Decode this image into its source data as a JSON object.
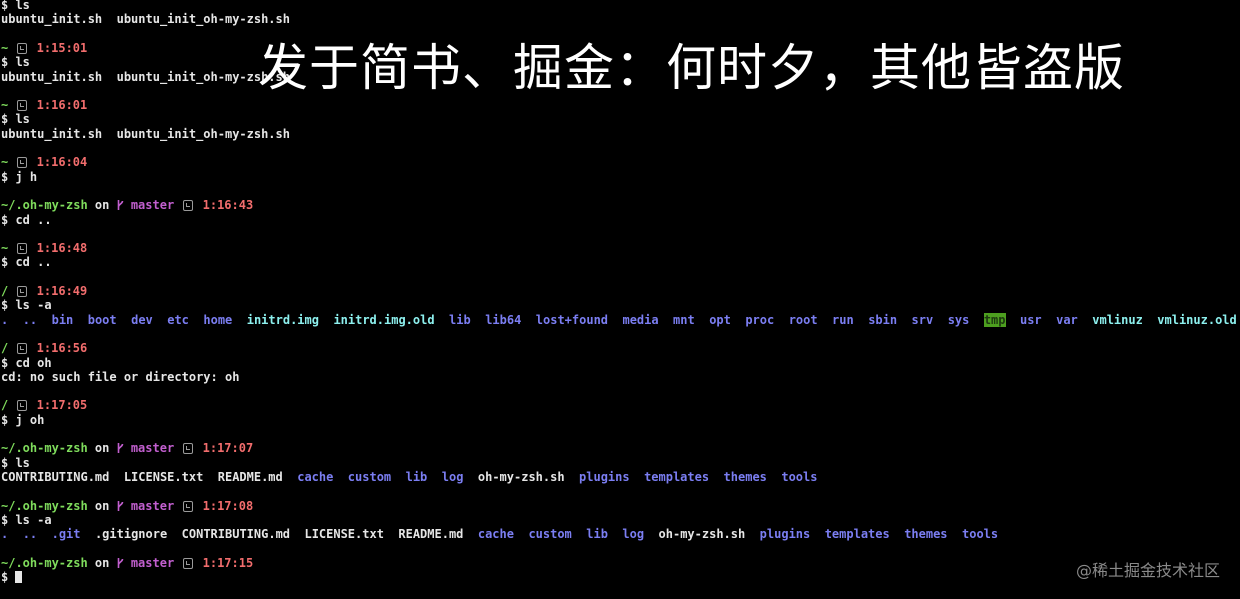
{
  "overlay": {
    "watermark": "发于简书、掘金：何时夕，其他皆盗版",
    "credit": "@稀土掘金技术社区"
  },
  "colors": {
    "path": "#7fdc5c",
    "branch": "#c25fcf",
    "time": "#f26d6d",
    "directory": "#7b7ef2",
    "symlink": "#8df0ee",
    "sticky_dir_bg": "#4d9f1f"
  },
  "terminal": {
    "lines": [
      [
        {
          "t": "$ ls",
          "s": "w"
        }
      ],
      [
        {
          "t": "ubuntu_init.sh  ubuntu_init_oh-my-zsh.sh",
          "s": "w"
        }
      ],
      [],
      [
        {
          "t": "~ ",
          "s": "g"
        },
        {
          "i": "clock-icon"
        },
        {
          "t": " 1:15:01",
          "s": "r"
        }
      ],
      [
        {
          "t": "$ ls",
          "s": "w"
        }
      ],
      [
        {
          "t": "ubuntu_init.sh  ubuntu_init_oh-my-zsh.sh",
          "s": "w"
        }
      ],
      [],
      [
        {
          "t": "~ ",
          "s": "g"
        },
        {
          "i": "clock-icon"
        },
        {
          "t": " 1:16:01",
          "s": "r"
        }
      ],
      [
        {
          "t": "$ ls",
          "s": "w"
        }
      ],
      [
        {
          "t": "ubuntu_init.sh  ubuntu_init_oh-my-zsh.sh",
          "s": "w"
        }
      ],
      [],
      [
        {
          "t": "~ ",
          "s": "g"
        },
        {
          "i": "clock-icon"
        },
        {
          "t": " 1:16:04",
          "s": "r"
        }
      ],
      [
        {
          "t": "$ j h",
          "s": "w"
        }
      ],
      [],
      [
        {
          "t": "~/.oh-my-zsh",
          "s": "g"
        },
        {
          "t": " on ",
          "s": "w"
        },
        {
          "i": "git-branch-icon"
        },
        {
          "t": " master ",
          "s": "m"
        },
        {
          "i": "clock-icon"
        },
        {
          "t": " 1:16:43",
          "s": "r"
        }
      ],
      [
        {
          "t": "$ cd ..",
          "s": "w"
        }
      ],
      [],
      [
        {
          "t": "~ ",
          "s": "g"
        },
        {
          "i": "clock-icon"
        },
        {
          "t": " 1:16:48",
          "s": "r"
        }
      ],
      [
        {
          "t": "$ cd ..",
          "s": "w"
        }
      ],
      [],
      [
        {
          "t": "/ ",
          "s": "g"
        },
        {
          "i": "clock-icon"
        },
        {
          "t": " 1:16:49",
          "s": "r"
        }
      ],
      [
        {
          "t": "$ ls -a",
          "s": "w"
        }
      ],
      [
        {
          "t": ".",
          "s": "b"
        },
        {
          "t": "  ",
          "s": "w"
        },
        {
          "t": "..",
          "s": "b"
        },
        {
          "t": "  ",
          "s": "w"
        },
        {
          "t": "bin",
          "s": "b"
        },
        {
          "t": "  ",
          "s": "w"
        },
        {
          "t": "boot",
          "s": "b"
        },
        {
          "t": "  ",
          "s": "w"
        },
        {
          "t": "dev",
          "s": "b"
        },
        {
          "t": "  ",
          "s": "w"
        },
        {
          "t": "etc",
          "s": "b"
        },
        {
          "t": "  ",
          "s": "w"
        },
        {
          "t": "home",
          "s": "b"
        },
        {
          "t": "  ",
          "s": "w"
        },
        {
          "t": "initrd.img",
          "s": "c"
        },
        {
          "t": "  ",
          "s": "w"
        },
        {
          "t": "initrd.img.old",
          "s": "c"
        },
        {
          "t": "  ",
          "s": "w"
        },
        {
          "t": "lib",
          "s": "b"
        },
        {
          "t": "  ",
          "s": "w"
        },
        {
          "t": "lib64",
          "s": "b"
        },
        {
          "t": "  ",
          "s": "w"
        },
        {
          "t": "lost+found",
          "s": "b"
        },
        {
          "t": "  ",
          "s": "w"
        },
        {
          "t": "media",
          "s": "b"
        },
        {
          "t": "  ",
          "s": "w"
        },
        {
          "t": "mnt",
          "s": "b"
        },
        {
          "t": "  ",
          "s": "w"
        },
        {
          "t": "opt",
          "s": "b"
        },
        {
          "t": "  ",
          "s": "w"
        },
        {
          "t": "proc",
          "s": "b"
        },
        {
          "t": "  ",
          "s": "w"
        },
        {
          "t": "root",
          "s": "b"
        },
        {
          "t": "  ",
          "s": "w"
        },
        {
          "t": "run",
          "s": "b"
        },
        {
          "t": "  ",
          "s": "w"
        },
        {
          "t": "sbin",
          "s": "b"
        },
        {
          "t": "  ",
          "s": "w"
        },
        {
          "t": "srv",
          "s": "b"
        },
        {
          "t": "  ",
          "s": "w"
        },
        {
          "t": "sys",
          "s": "b"
        },
        {
          "t": "  ",
          "s": "w"
        },
        {
          "t": "tmp",
          "s": "t"
        },
        {
          "t": "  ",
          "s": "w"
        },
        {
          "t": "usr",
          "s": "b"
        },
        {
          "t": "  ",
          "s": "w"
        },
        {
          "t": "var",
          "s": "b"
        },
        {
          "t": "  ",
          "s": "w"
        },
        {
          "t": "vmlinuz",
          "s": "c"
        },
        {
          "t": "  ",
          "s": "w"
        },
        {
          "t": "vmlinuz.old",
          "s": "c"
        }
      ],
      [],
      [
        {
          "t": "/ ",
          "s": "g"
        },
        {
          "i": "clock-icon"
        },
        {
          "t": " 1:16:56",
          "s": "r"
        }
      ],
      [
        {
          "t": "$ cd oh",
          "s": "w"
        }
      ],
      [
        {
          "t": "cd: no such file or directory: oh",
          "s": "w"
        }
      ],
      [],
      [
        {
          "t": "/ ",
          "s": "g"
        },
        {
          "i": "clock-icon"
        },
        {
          "t": " 1:17:05",
          "s": "r"
        }
      ],
      [
        {
          "t": "$ j oh",
          "s": "w"
        }
      ],
      [],
      [
        {
          "t": "~/.oh-my-zsh",
          "s": "g"
        },
        {
          "t": " on ",
          "s": "w"
        },
        {
          "i": "git-branch-icon"
        },
        {
          "t": " master ",
          "s": "m"
        },
        {
          "i": "clock-icon"
        },
        {
          "t": " 1:17:07",
          "s": "r"
        }
      ],
      [
        {
          "t": "$ ls",
          "s": "w"
        }
      ],
      [
        {
          "t": "CONTRIBUTING.md  LICENSE.txt  README.md  ",
          "s": "w"
        },
        {
          "t": "cache",
          "s": "b"
        },
        {
          "t": "  ",
          "s": "w"
        },
        {
          "t": "custom",
          "s": "b"
        },
        {
          "t": "  ",
          "s": "w"
        },
        {
          "t": "lib",
          "s": "b"
        },
        {
          "t": "  ",
          "s": "w"
        },
        {
          "t": "log",
          "s": "b"
        },
        {
          "t": "  oh-my-zsh.sh  ",
          "s": "w"
        },
        {
          "t": "plugins",
          "s": "b"
        },
        {
          "t": "  ",
          "s": "w"
        },
        {
          "t": "templates",
          "s": "b"
        },
        {
          "t": "  ",
          "s": "w"
        },
        {
          "t": "themes",
          "s": "b"
        },
        {
          "t": "  ",
          "s": "w"
        },
        {
          "t": "tools",
          "s": "b"
        }
      ],
      [],
      [
        {
          "t": "~/.oh-my-zsh",
          "s": "g"
        },
        {
          "t": " on ",
          "s": "w"
        },
        {
          "i": "git-branch-icon"
        },
        {
          "t": " master ",
          "s": "m"
        },
        {
          "i": "clock-icon"
        },
        {
          "t": " 1:17:08",
          "s": "r"
        }
      ],
      [
        {
          "t": "$ ls -a",
          "s": "w"
        }
      ],
      [
        {
          "t": ".",
          "s": "b"
        },
        {
          "t": "  ",
          "s": "w"
        },
        {
          "t": "..",
          "s": "b"
        },
        {
          "t": "  ",
          "s": "w"
        },
        {
          "t": ".git",
          "s": "b"
        },
        {
          "t": "  .gitignore  CONTRIBUTING.md  LICENSE.txt  README.md  ",
          "s": "w"
        },
        {
          "t": "cache",
          "s": "b"
        },
        {
          "t": "  ",
          "s": "w"
        },
        {
          "t": "custom",
          "s": "b"
        },
        {
          "t": "  ",
          "s": "w"
        },
        {
          "t": "lib",
          "s": "b"
        },
        {
          "t": "  ",
          "s": "w"
        },
        {
          "t": "log",
          "s": "b"
        },
        {
          "t": "  oh-my-zsh.sh  ",
          "s": "w"
        },
        {
          "t": "plugins",
          "s": "b"
        },
        {
          "t": "  ",
          "s": "w"
        },
        {
          "t": "templates",
          "s": "b"
        },
        {
          "t": "  ",
          "s": "w"
        },
        {
          "t": "themes",
          "s": "b"
        },
        {
          "t": "  ",
          "s": "w"
        },
        {
          "t": "tools",
          "s": "b"
        }
      ],
      [],
      [
        {
          "t": "~/.oh-my-zsh",
          "s": "g"
        },
        {
          "t": " on ",
          "s": "w"
        },
        {
          "i": "git-branch-icon"
        },
        {
          "t": " master ",
          "s": "m"
        },
        {
          "i": "clock-icon"
        },
        {
          "t": " 1:17:15",
          "s": "r"
        }
      ],
      [
        {
          "t": "$ ",
          "s": "w"
        },
        {
          "i": "cursor"
        }
      ]
    ]
  }
}
